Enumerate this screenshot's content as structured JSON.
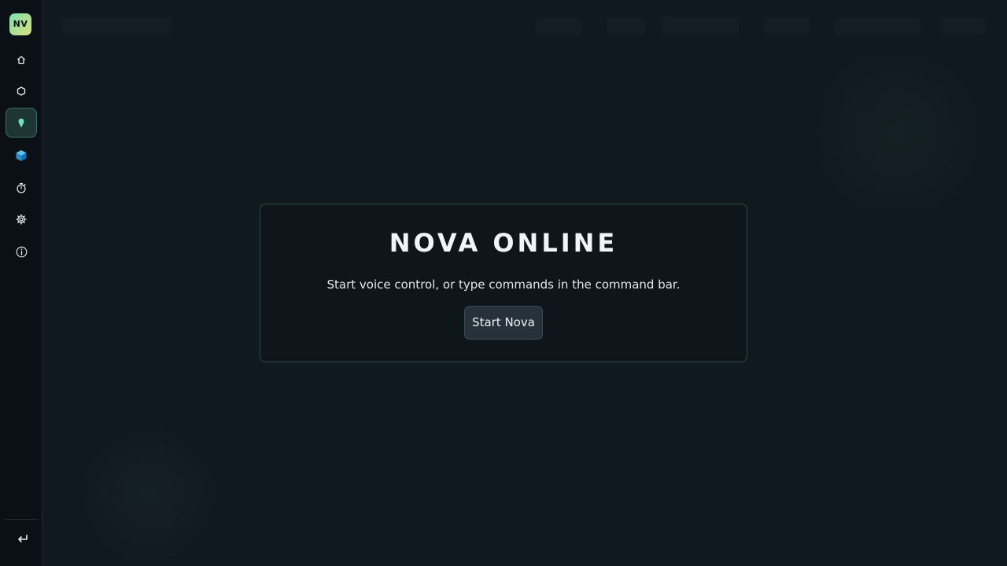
{
  "brand": {
    "logo_text": "NV"
  },
  "sidebar": {
    "items": [
      {
        "icon": "home-icon",
        "active": false
      },
      {
        "icon": "hexagon-icon",
        "active": false
      },
      {
        "icon": "location-pin-icon",
        "active": true
      },
      {
        "icon": "cube-icon",
        "active": false
      },
      {
        "icon": "stopwatch-icon",
        "active": false
      },
      {
        "icon": "gear-icon",
        "active": false
      },
      {
        "icon": "info-icon",
        "active": false
      }
    ],
    "footer_icon": "return-icon"
  },
  "panel": {
    "title": "NOVA ONLINE",
    "subtitle": "Start voice control, or type commands in the command bar.",
    "button_label": "Start Nova"
  },
  "colors": {
    "background": "#111920",
    "sidebar": "#0b1017",
    "accent": "#6fe0c6",
    "panel_border": "#2d4a49"
  }
}
